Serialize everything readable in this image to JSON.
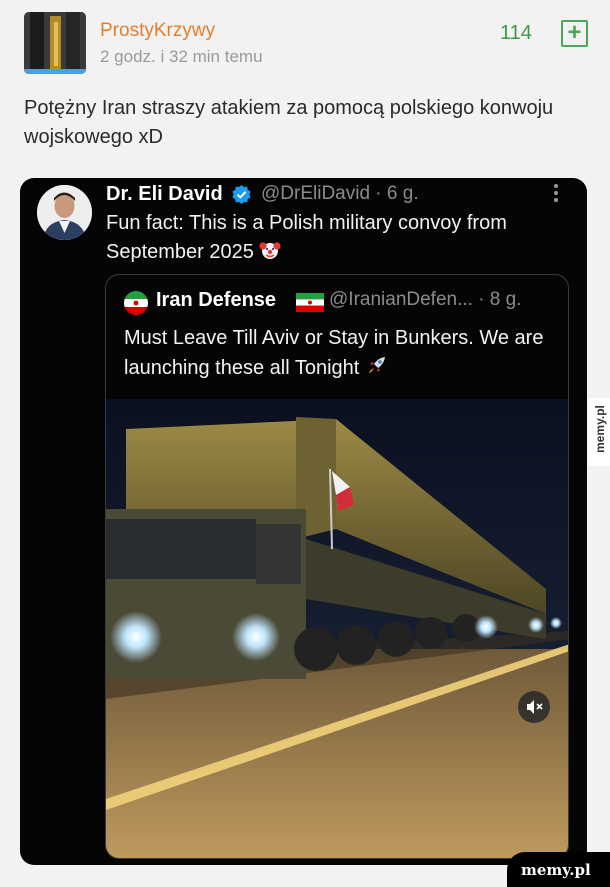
{
  "post": {
    "username": "ProstyKrzywy",
    "timestamp": "2 godz. i 32 min temu",
    "votes": "114",
    "vote_button": "+",
    "text": "Potężny Iran straszy atakiem za pomocą polskiego konwoju wojskowego xD"
  },
  "tweet": {
    "name": "Dr. Eli David",
    "handle": "@DrEliDavid · 6 g.",
    "text": "Fun fact: This is a Polish military convoy from September 2025",
    "quote": {
      "name": "Iran Defense",
      "handle": "@IranianDefen... · 8 g.",
      "text": "Must Leave Till Aviv or Stay in Bunkers. We are launching these all Tonight"
    }
  },
  "watermark": {
    "side": "memy.pl",
    "bottom": "memy.pl"
  },
  "colors": {
    "username": "#e77d2a",
    "votes": "#3c9a3c",
    "verified": "#1d9bf0"
  }
}
